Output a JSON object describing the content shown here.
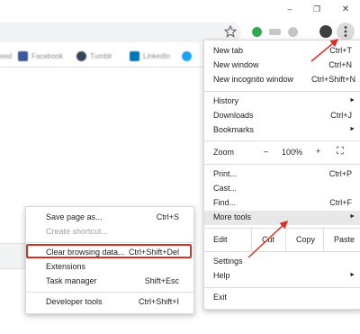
{
  "window": {
    "minimize_glyph": "–",
    "maximize_glyph": "❐",
    "close_glyph": "✕"
  },
  "toolbar": {
    "icons": [
      "star-icon",
      "extension-green-icon",
      "extension-gray-icon",
      "extension-dots-icon",
      "profile-avatar-icon",
      "kebab-menu-icon"
    ]
  },
  "bookmarks": [
    {
      "label": "eed",
      "color": "#5f6368"
    },
    {
      "label": "Facebook",
      "color": "#3b5998"
    },
    {
      "label": "Tumblr",
      "color": "#35465c"
    },
    {
      "label": "LinkedIn",
      "color": "#0077b5"
    },
    {
      "label": "",
      "color": "#1da1f2"
    }
  ],
  "main_menu": {
    "new_tab": {
      "label": "New tab",
      "shortcut": "Ctrl+T"
    },
    "new_window": {
      "label": "New window",
      "shortcut": "Ctrl+N"
    },
    "incognito": {
      "label": "New incognito window",
      "shortcut": "Ctrl+Shift+N"
    },
    "history": {
      "label": "History",
      "arrow": "►"
    },
    "downloads": {
      "label": "Downloads",
      "shortcut": "Ctrl+J"
    },
    "bookmarks": {
      "label": "Bookmarks",
      "arrow": "►"
    },
    "zoom": {
      "label": "Zoom",
      "minus": "–",
      "value": "100%",
      "plus": "+",
      "fullscreen": "⛶"
    },
    "print": {
      "label": "Print...",
      "shortcut": "Ctrl+P"
    },
    "cast": {
      "label": "Cast..."
    },
    "find": {
      "label": "Find...",
      "shortcut": "Ctrl+F"
    },
    "more_tools": {
      "label": "More tools",
      "arrow": "►"
    },
    "edit": {
      "label": "Edit",
      "cut": "Cut",
      "copy": "Copy",
      "paste": "Paste"
    },
    "settings": {
      "label": "Settings"
    },
    "help": {
      "label": "Help",
      "arrow": "►"
    },
    "exit": {
      "label": "Exit"
    }
  },
  "submenu": {
    "save_page": {
      "label": "Save page as...",
      "shortcut": "Ctrl+S"
    },
    "create_shortcut": {
      "label": "Create shortcut..."
    },
    "clear_data": {
      "label": "Clear browsing data...",
      "shortcut": "Ctrl+Shift+Del"
    },
    "extensions": {
      "label": "Extensions"
    },
    "task_manager": {
      "label": "Task manager",
      "shortcut": "Shift+Esc"
    },
    "dev_tools": {
      "label": "Developer tools",
      "shortcut": "Ctrl+Shift+I"
    }
  },
  "colors": {
    "highlight": "#d93025",
    "arrow": "#d93025",
    "hover": "#e8e8e8"
  }
}
